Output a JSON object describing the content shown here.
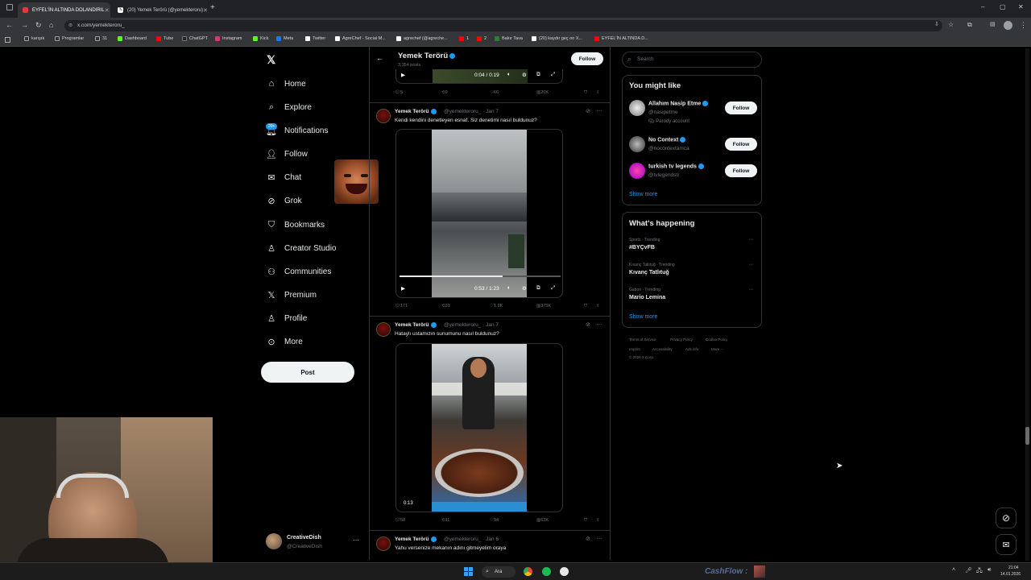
{
  "browser": {
    "tabs": [
      {
        "label": "EYFEL'İN ALTINDA DOLANDIRIL",
        "active": true,
        "color": "#e53935"
      },
      {
        "label": "(20) Yemek Terörü (@yemekteroru)",
        "active": false,
        "color": "#ffffff"
      }
    ],
    "url": "x.com/yemekteroru_",
    "bookmarks": [
      {
        "label": "karışık",
        "color": "#9e9e9e"
      },
      {
        "label": "Programlar",
        "color": "#9e9e9e"
      },
      {
        "label": "31",
        "color": "#9e9e9e"
      },
      {
        "label": "Dashboard",
        "color": "#53fc18"
      },
      {
        "label": "Tube",
        "color": "#ff0000"
      },
      {
        "label": "ChatGPT",
        "color": "#222222"
      },
      {
        "label": "Instagram",
        "color": "#e1306c"
      },
      {
        "label": "Kick",
        "color": "#53fc18"
      },
      {
        "label": "Meta",
        "color": "#1877f2"
      },
      {
        "label": "Twitter",
        "color": "#ffffff"
      },
      {
        "label": "AgreChef - Social M...",
        "color": "#ffffff"
      },
      {
        "label": "agrechef (@agreche...",
        "color": "#ffffff"
      },
      {
        "label": "1",
        "color": "#ff0000"
      },
      {
        "label": "2",
        "color": "#ff0000"
      },
      {
        "label": "Bakır Tava",
        "color": "#2e7d32"
      },
      {
        "label": "(20) kaydır geç on X...",
        "color": "#ffffff"
      },
      {
        "label": "EYFEL'İN ALTINDA D...",
        "color": "#ff0000"
      }
    ]
  },
  "nav": {
    "items": [
      {
        "label": "Home",
        "icon": "home-icon",
        "glyph": "⌂"
      },
      {
        "label": "Explore",
        "icon": "search-icon",
        "glyph": "⌕"
      },
      {
        "label": "Notifications",
        "icon": "bell-icon",
        "glyph": "🔔︎",
        "badge": "20+"
      },
      {
        "label": "Follow",
        "icon": "person-plus-icon",
        "glyph": "👤︎"
      },
      {
        "label": "Chat",
        "icon": "mail-icon",
        "glyph": "✉"
      },
      {
        "label": "Grok",
        "icon": "grok-icon",
        "glyph": "⊘"
      },
      {
        "label": "Bookmarks",
        "icon": "bookmark-icon",
        "glyph": "⛉"
      },
      {
        "label": "Creator Studio",
        "icon": "creator-icon",
        "glyph": "♙"
      },
      {
        "label": "Communities",
        "icon": "communities-icon",
        "glyph": "⚇"
      },
      {
        "label": "Premium",
        "icon": "x-logo-icon",
        "glyph": "𝕏"
      },
      {
        "label": "Profile",
        "icon": "profile-icon",
        "glyph": "♙"
      },
      {
        "label": "More",
        "icon": "more-icon",
        "glyph": "⊙"
      }
    ],
    "post_label": "Post",
    "account": {
      "name": "CreativeDish",
      "handle": "@CreativeDish"
    }
  },
  "profile_header": {
    "name": "Yemek Terörü",
    "posts": "3,354 posts",
    "follow_label": "Follow"
  },
  "tweets": [
    {
      "video_time": "0:04 / 0:19",
      "stats": {
        "replies": "5",
        "reposts": "9",
        "likes": "66",
        "views": "20K"
      }
    },
    {
      "name": "Yemek Terörü",
      "handle": "@yemekteroru_ · Jan 7",
      "text": "Kendi kendini denetleyen esnaf. Siz denetimi nasıl buldunuz?",
      "video_time": "0:53 / 1:23",
      "stats": {
        "replies": "171",
        "reposts": "31",
        "likes": "1.9K",
        "views": "375K"
      }
    },
    {
      "name": "Yemek Terörü",
      "handle": "@yemekteroru_ · Jan 7",
      "text": "Hataylı ustamızın sunumunu nasıl buldunuz?",
      "video_time": "0:13",
      "stats": {
        "replies": "58",
        "reposts": "11",
        "likes": "94",
        "views": "63K"
      }
    },
    {
      "name": "Yemek Terörü",
      "handle": "@yemekteroru_ · Jan 6",
      "text": "Yahu versenize mekanın adını gitmeyelim oraya"
    }
  ],
  "sidebar": {
    "search_placeholder": "Search",
    "you_might_like": {
      "title": "You might like",
      "accounts": [
        {
          "name": "Allahım Nasip Etme",
          "handle": "@nasipetme",
          "note": "Parody account",
          "follow": "Follow"
        },
        {
          "name": "No Context",
          "handle": "@nocontextamca",
          "follow": "Follow"
        },
        {
          "name": "turkish tv legends",
          "handle": "@tvlegendstr",
          "follow": "Follow"
        }
      ],
      "show_more": "Show more"
    },
    "whats_happening": {
      "title": "What's happening",
      "trends": [
        {
          "category": "Sports · Trending",
          "name": "#BYÇvFB"
        },
        {
          "category": "Kıvanç Tatlıtuğ · Trending",
          "name": "Kıvanç Tatlıtuğ"
        },
        {
          "category": "Gabon · Trending",
          "name": "Mario Lemina"
        }
      ],
      "show_more": "Show more"
    },
    "footer": [
      "Terms of Service",
      "Privacy Policy",
      "Cookie Policy",
      "Imprint",
      "Accessibility",
      "Ads info",
      "More ···",
      "© 2026 X Corp."
    ]
  },
  "taskbar": {
    "search_label": "Ara",
    "overlay_text": "CashFlow :",
    "clock_time": "21:04",
    "clock_date": "14.01.2026"
  }
}
